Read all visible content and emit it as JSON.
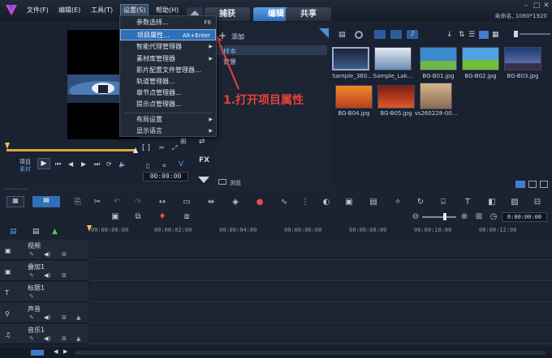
{
  "menubar": {
    "items": [
      "文件(F)",
      "编辑(E)",
      "工具(T)",
      "设置(S)",
      "帮助(H)"
    ],
    "tabs": [
      "捕获",
      "编辑",
      "共享"
    ],
    "active_tab": "编辑",
    "window_info": "未命名, 1080*1920"
  },
  "settings_menu": {
    "items": [
      {
        "label": "参数选择...",
        "shortcut": "F6"
      },
      {
        "label": "项目属性...",
        "shortcut": "Alt+Enter",
        "highlighted": true
      },
      {
        "label": "智能代理管理器",
        "submenu": true
      },
      {
        "label": "素材库管理器",
        "submenu": true
      },
      {
        "label": "影片配置文件管理器..."
      },
      {
        "label": "轨道管理器..."
      },
      {
        "label": "章节点管理器..."
      },
      {
        "label": "提示点管理器..."
      },
      {
        "label": "布局设置",
        "submenu": true
      },
      {
        "label": "显示语言",
        "submenu": true
      }
    ]
  },
  "player": {
    "project_label": "项目",
    "clip_label": "素材",
    "timecode": "00:00:00",
    "bracket_controls": "[ ]"
  },
  "library": {
    "add_label": "添加",
    "folders": [
      "样本",
      "背景"
    ],
    "browse_label": "浏览",
    "thumbnails": [
      {
        "label": "Sample_360...",
        "color": "#2d3a56"
      },
      {
        "label": "Sample_Lak...",
        "color": "#5f7ea6"
      },
      {
        "label": "BG-B01.jpg",
        "color": "#3a8ad0"
      },
      {
        "label": "BG-B02.jpg",
        "color": "#4fa3e0"
      },
      {
        "label": "BG-B03.jpg",
        "color": "#2b4a8a"
      },
      {
        "label": "BG-B04.jpg",
        "color": "#e06a1c"
      },
      {
        "label": "BG-B05.jpg",
        "color": "#b8402a"
      },
      {
        "label": "vs260228-00...",
        "color": "#c9a37a"
      }
    ]
  },
  "annotation": "1.打开项目属性",
  "timeline": {
    "timecode": "0:00:00:00",
    "ruler": [
      "00:00:00:00",
      "00:00:02:00",
      "00:00:04:00",
      "00:00:06:00",
      "00:00:08:00",
      "00:00:10:00",
      "00:00:12:00"
    ],
    "tracks": [
      "视频",
      "叠加1",
      "标题1",
      "声音",
      "音乐1"
    ]
  },
  "colors": {
    "accent": "#2f6fb6",
    "annotation": "#e8423a"
  }
}
